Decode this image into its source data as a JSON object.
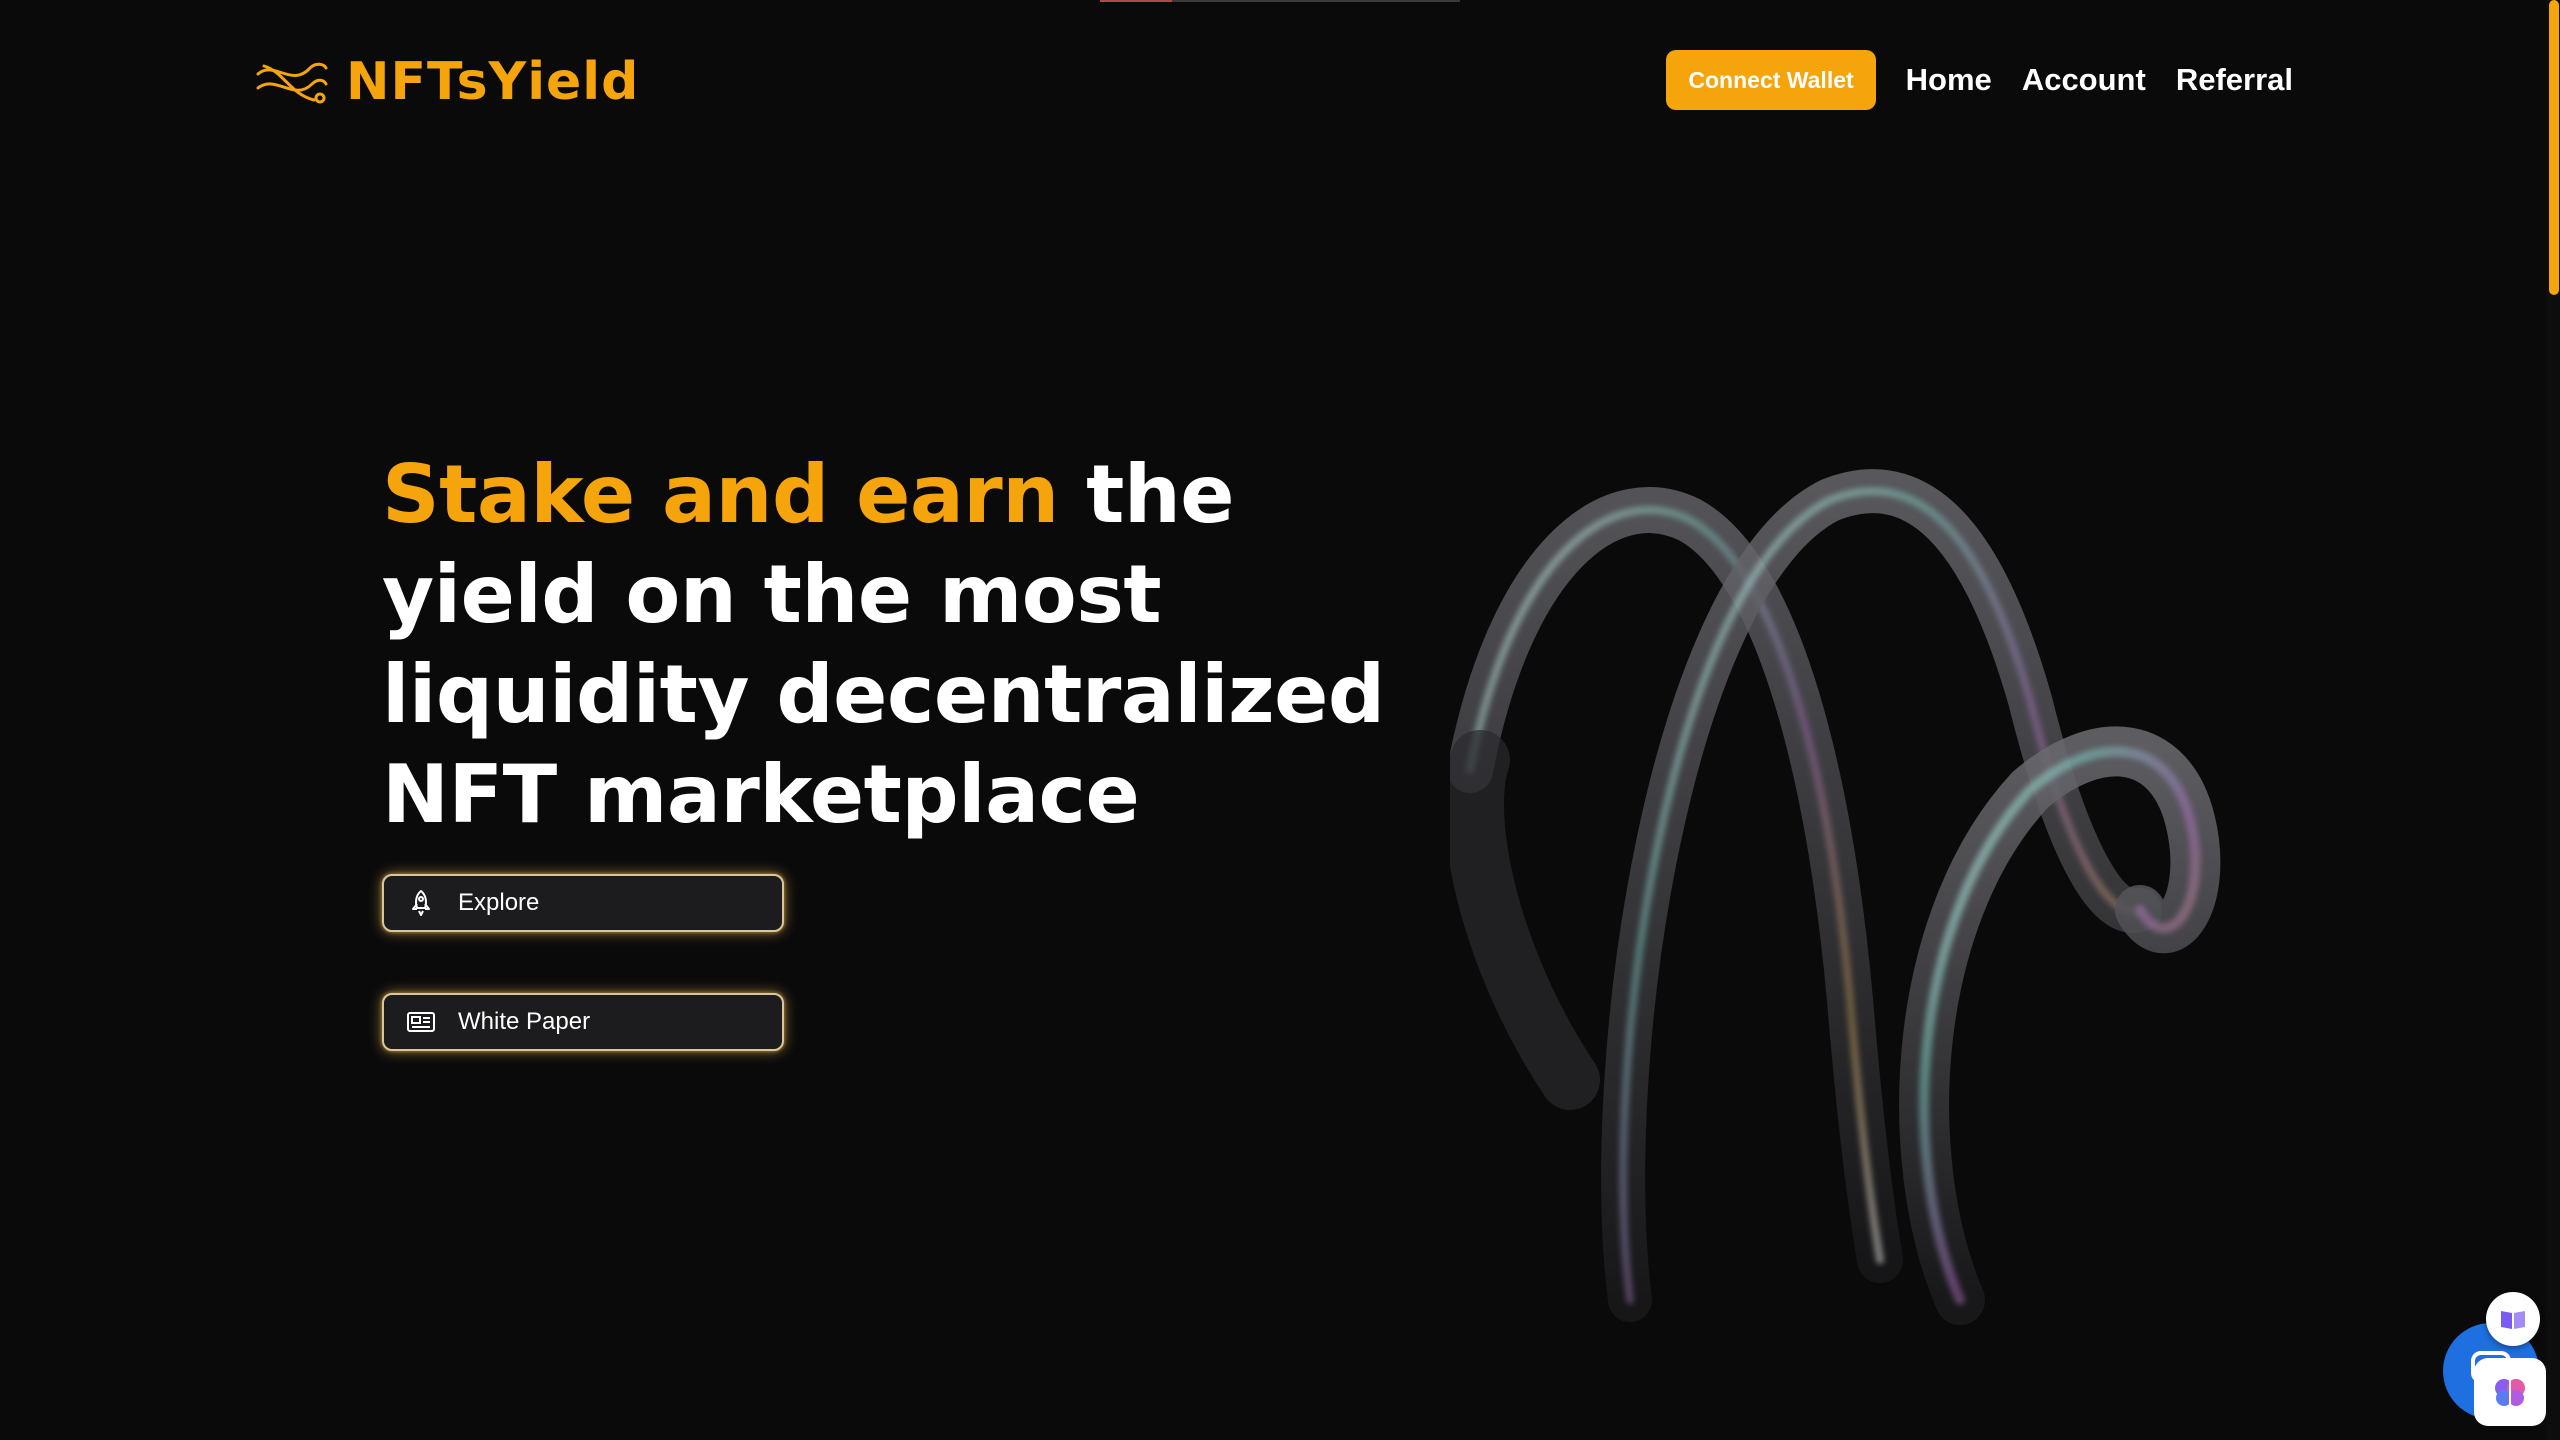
{
  "header": {
    "logo_text": "NFTsYield",
    "connect_wallet_label": "Connect Wallet",
    "nav": [
      "Home",
      "Account",
      "Referral"
    ]
  },
  "hero": {
    "headline_accent": "Stake and earn",
    "headline_rest": " the yield on the most liquidity decentralized NFT marketplace",
    "buttons": [
      {
        "label": "Explore",
        "icon": "rocket-icon"
      },
      {
        "label": "White Paper",
        "icon": "newspaper-icon"
      }
    ]
  },
  "colors": {
    "accent": "#f5a40c",
    "background": "#0a0a0b",
    "text": "#ffffff",
    "button_bg": "#1c1c1e",
    "chat_blue": "#1e6fe0"
  },
  "widgets": [
    "book-icon",
    "chat-icon",
    "brain-icon"
  ]
}
